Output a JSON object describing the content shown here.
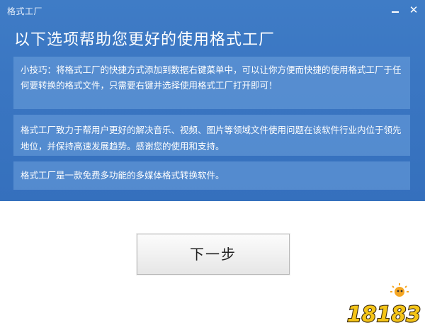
{
  "window": {
    "title": "格式工厂",
    "close_glyph": "✕"
  },
  "heading": "以下选项帮助您更好的使用格式工厂",
  "panels": [
    {
      "text": "小技巧：将格式工厂的快捷方式添加到数据右键菜单中，可以让你方便而快捷的使用格式工厂于任何要转换的格式文件，只需要右键并选择使用格式工厂打开即可！"
    },
    {
      "text": "格式工厂致力于帮用户更好的解决音乐、视频、图片等领域文件使用问题在该软件行业内位于领先地位，并保持高速发展趋势。感谢您的使用和支持。"
    },
    {
      "text": "格式工厂是一款免费多功能的多媒体格式转换软件。"
    }
  ],
  "next_button": {
    "label": "下一步"
  },
  "watermark": {
    "text": "18183"
  },
  "colors": {
    "window_blue": "#3a76c2",
    "panel_blue": "#6ea0dc",
    "watermark_orange": "#f5a623"
  }
}
